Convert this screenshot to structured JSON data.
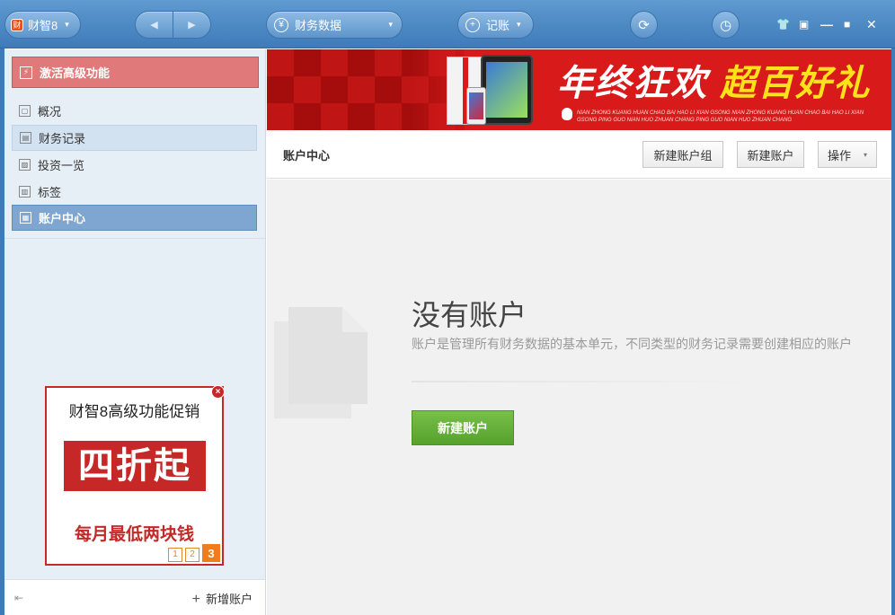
{
  "titlebar": {
    "app_name": "财智8",
    "app_logo": "财",
    "back_icon": "◀",
    "forward_icon": "▶",
    "data_menu": "财务数据",
    "data_icon": "¥",
    "record_menu": "记账",
    "record_icon": "+",
    "caret": "▾",
    "refresh_icon": "⟳",
    "history_icon": "◷",
    "controls": {
      "skin": "👕",
      "feedback": "▣",
      "minimize": "—",
      "maximize": "■",
      "close": "✕"
    }
  },
  "sidebar": {
    "activate_label": "激活高级功能",
    "items": [
      {
        "label": "概况",
        "icon": "▢"
      },
      {
        "label": "财务记录",
        "icon": "▤"
      },
      {
        "label": "投资一览",
        "icon": "▨"
      },
      {
        "label": "标签",
        "icon": "▥"
      },
      {
        "label": "账户中心",
        "icon": "▦"
      }
    ],
    "promo": {
      "title": "财智8高级功能促销",
      "big": "四折起",
      "sub": "每月最低两块钱",
      "close": "×",
      "pages": [
        "1",
        "2",
        "3"
      ]
    },
    "bottom": {
      "collapse_icon": "⇤",
      "add_plus": "+",
      "add_label": "新增账户"
    }
  },
  "banner": {
    "text_white": "年终狂欢 ",
    "text_yellow": "超百好礼",
    "small_text": "NIAN ZHONG KUANG HUAN CHAO BAI HAO LI XIAN GSONG NIAN ZHONG KUANG HUAN CHAO BAI HAO LI XIAN GSONG PING GUO NIAN HUO ZHUAN CHANG PING GUO NIAN HUO ZHUAN CHANG"
  },
  "toolbar": {
    "title": "账户中心",
    "new_group": "新建账户组",
    "new_account": "新建账户",
    "operations": "操作",
    "operations_caret": "▾"
  },
  "empty_state": {
    "title": "没有账户",
    "description": "账户是管理所有财务数据的基本单元，不同类型的财务记录需要创建相应的账户",
    "button": "新建账户"
  }
}
